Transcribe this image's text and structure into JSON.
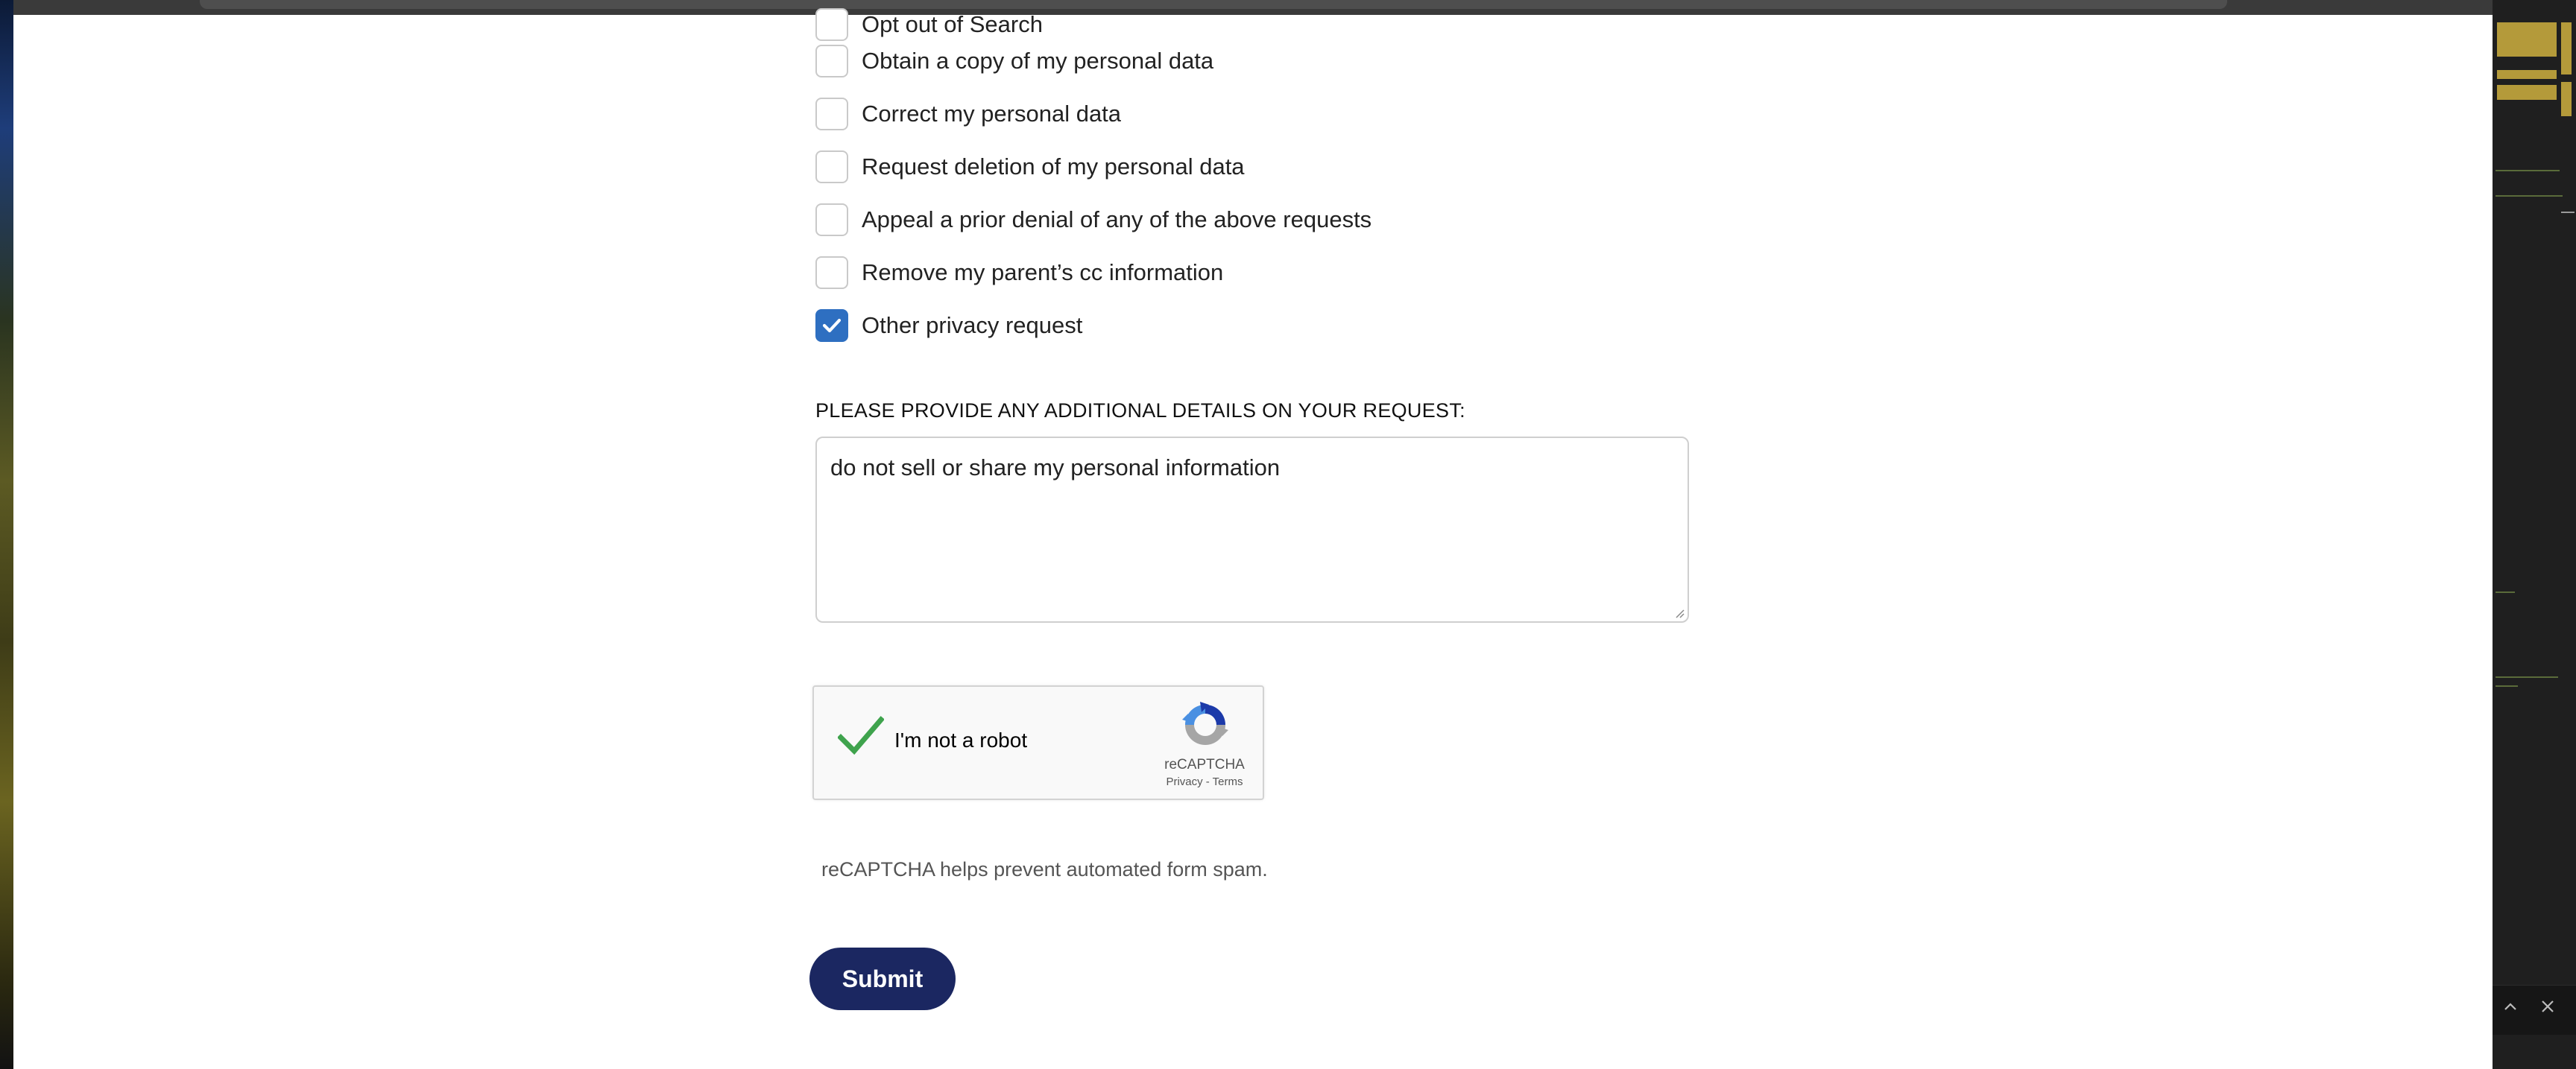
{
  "form": {
    "checkboxes": [
      {
        "label": "Opt out of Search",
        "checked": false
      },
      {
        "label": "Obtain a copy of my personal data",
        "checked": false
      },
      {
        "label": "Correct my personal data",
        "checked": false
      },
      {
        "label": "Request deletion of my personal data",
        "checked": false
      },
      {
        "label": "Appeal a prior denial of any of the above requests",
        "checked": false
      },
      {
        "label": "Remove my parent’s cc information",
        "checked": false
      },
      {
        "label": "Other privacy request",
        "checked": true
      }
    ],
    "details_label": "PLEASE PROVIDE ANY ADDITIONAL DETAILS ON YOUR REQUEST:",
    "details_value": "do not sell or share my personal information",
    "helper_text": "reCAPTCHA helps prevent automated form spam.",
    "submit_label": "Submit"
  },
  "recaptcha": {
    "label": "I'm not a robot",
    "brand": "reCAPTCHA",
    "links": "Privacy - Terms",
    "verified": true
  },
  "colors": {
    "accent_checkbox": "#2e6fc1",
    "submit_bg": "#1b2761",
    "recaptcha_check": "#3fa34d"
  },
  "icons": {
    "checkbox_checked": "checkmark-icon",
    "recaptcha_check": "check-icon",
    "recaptcha_logo": "recaptcha-logo-icon",
    "panel_up": "chevron-up-icon",
    "panel_close": "close-icon"
  }
}
